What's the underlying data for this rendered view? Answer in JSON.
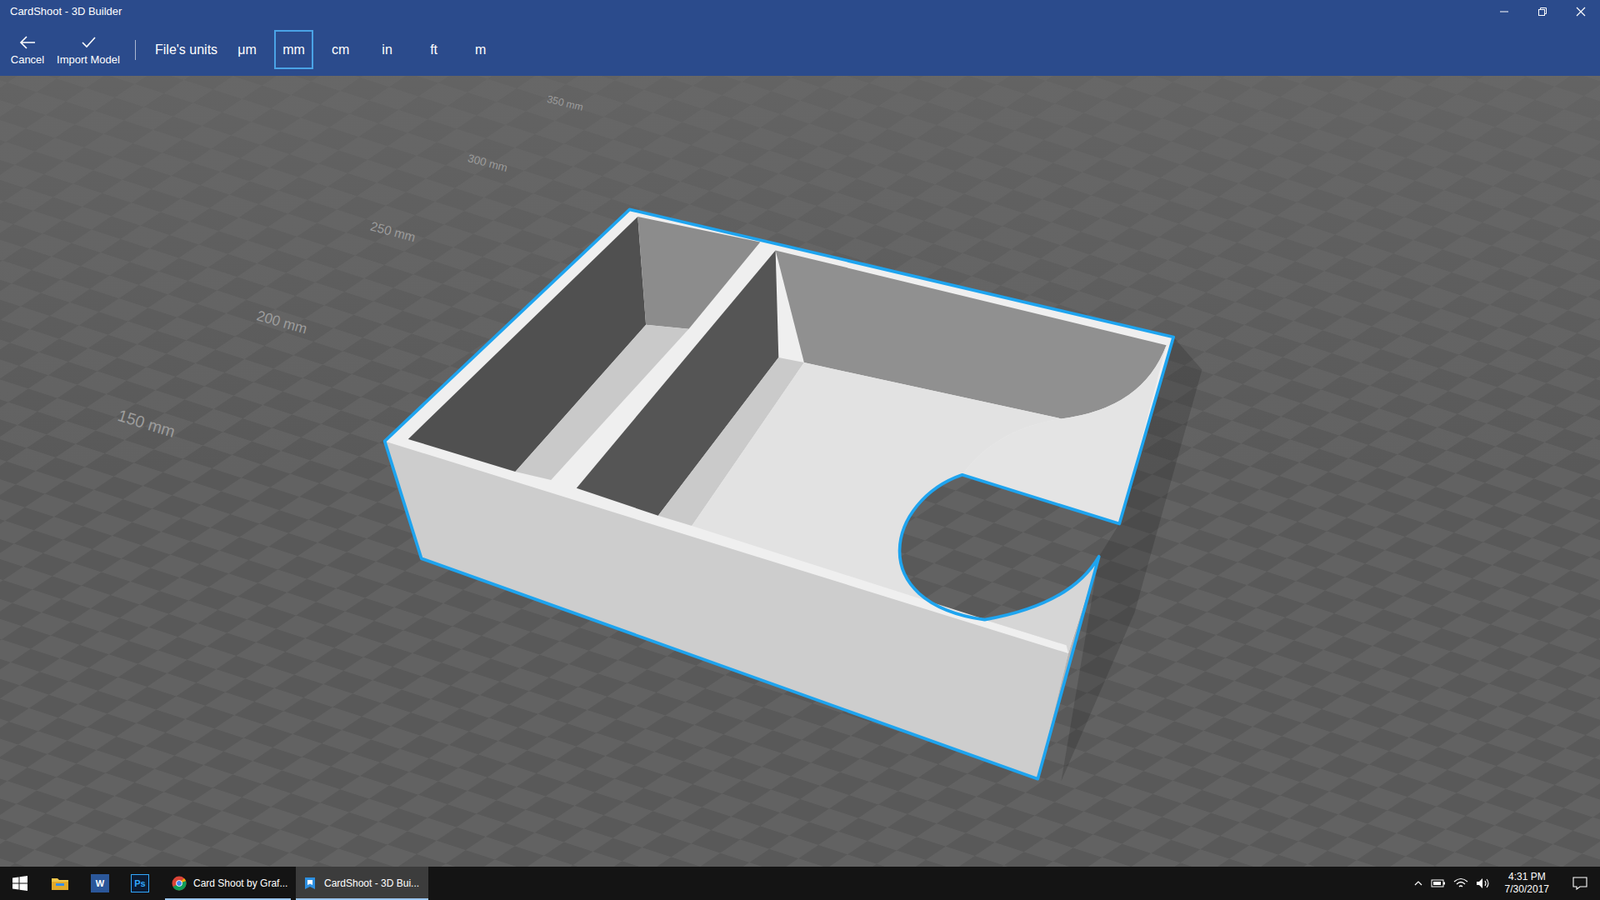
{
  "window": {
    "title": "CardShoot - 3D Builder"
  },
  "toolbar": {
    "actions": [
      {
        "label": "Cancel",
        "kind": "back"
      },
      {
        "label": "Import Model",
        "kind": "check"
      }
    ],
    "units_label": "File's units",
    "units": [
      {
        "label": "μm",
        "selected": false
      },
      {
        "label": "mm",
        "selected": true
      },
      {
        "label": "cm",
        "selected": false
      },
      {
        "label": "in",
        "selected": false
      },
      {
        "label": "ft",
        "selected": false
      },
      {
        "label": "m",
        "selected": false
      }
    ]
  },
  "viewport": {
    "axis_labels": [
      "350 mm",
      "300 mm",
      "250 mm",
      "200 mm",
      "150 mm"
    ],
    "model": {
      "selected": true
    }
  },
  "taskbar": {
    "pinned": [
      {
        "kind": "start"
      },
      {
        "kind": "explorer"
      },
      {
        "kind": "word",
        "glyph": "W"
      },
      {
        "kind": "photoshop",
        "glyph": "Ps"
      }
    ],
    "windows": [
      {
        "label": "Card Shoot by Graf...",
        "kind": "chrome",
        "selected": false
      },
      {
        "label": "CardShoot - 3D Bui...",
        "kind": "builder",
        "selected": true
      }
    ],
    "clock": {
      "time": "4:31 PM",
      "date": "7/30/2017"
    }
  }
}
